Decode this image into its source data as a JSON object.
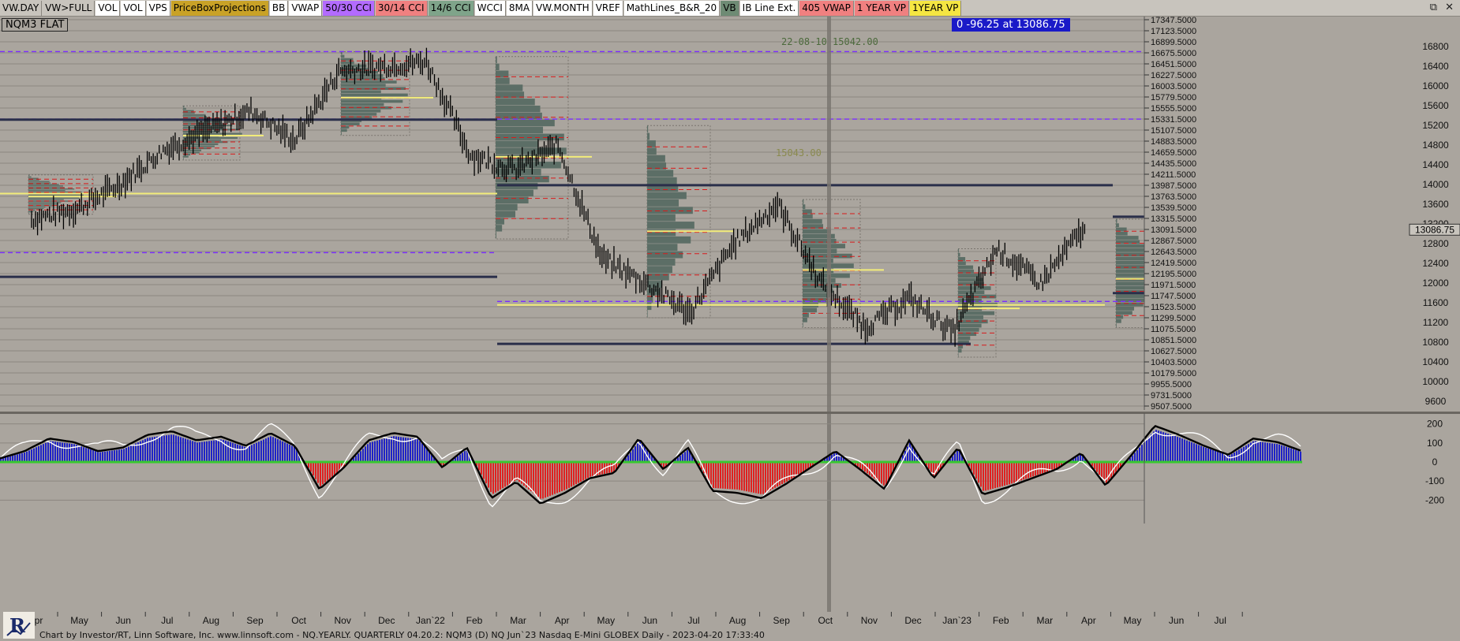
{
  "toolbar": {
    "buttons": [
      {
        "label": "VW.DAY",
        "bg": "#c8c4bd"
      },
      {
        "label": "VW>FULL",
        "bg": "#c8c4bd"
      },
      {
        "label": "VOL",
        "bg": "#ffffff"
      },
      {
        "label": "VOL",
        "bg": "#ffffff"
      },
      {
        "label": "VPS",
        "bg": "#ffffff"
      },
      {
        "label": "PriceBoxProjections",
        "bg": "#c9a227"
      },
      {
        "label": "BB",
        "bg": "#ffffff"
      },
      {
        "label": "VWAP",
        "bg": "#ffffff"
      },
      {
        "label": "50/30 CCI",
        "bg": "#b36bff"
      },
      {
        "label": "30/14 CCI",
        "bg": "#f08080"
      },
      {
        "label": "14/6 CCI",
        "bg": "#7fa48a"
      },
      {
        "label": "WCCI",
        "bg": "#ffffff"
      },
      {
        "label": "8MA",
        "bg": "#ffffff"
      },
      {
        "label": "VW.MONTH",
        "bg": "#ffffff"
      },
      {
        "label": "VREF",
        "bg": "#ffffff"
      },
      {
        "label": "MathLines_B&R_20",
        "bg": "#ffffff"
      },
      {
        "label": "VB",
        "bg": "#6e8b74"
      },
      {
        "label": "IB Line Ext.",
        "bg": "#ffffff"
      },
      {
        "label": "405 VWAP",
        "bg": "#f08080"
      },
      {
        "label": "1 YEAR VP",
        "bg": "#f08080"
      },
      {
        "label": "1YEAR VP",
        "bg": "#f5e642"
      }
    ],
    "window_controls": [
      "⧉",
      "✕"
    ]
  },
  "symbol_label": "NQM3 FLAT",
  "readout": "0  -96.25 at 13086.75",
  "annotations": [
    "22-08-10  15042.00",
    "15043.00"
  ],
  "footer": "Chart by Investor/RT, Linn Software, Inc. www.linnsoft.com - NQ.YEARLY. QUARTERLY    04.20.2: NQM3 (D) NQ Jun`23 Nasdaq E-Mini GLOBEX Daily - 2023-04-20 17:33:40",
  "colors": {
    "background": "#aaa59e",
    "candles": "#000000",
    "profile": "#5c6e66",
    "red_dash": "#d81b1b",
    "purple_dash": "#7b2cff",
    "yellow_line": "#f2ec7a",
    "navy_line": "#2a2f4a",
    "cci_positive": "#1f22c8",
    "cci_negative": "#e02020",
    "cci_zero": "#38c830",
    "cci_fast": "#ffffff",
    "cci_slow": "#000000"
  },
  "chart_data": {
    "type": "line",
    "title": "NQM3 FLAT",
    "price_axis": {
      "labels": [
        "17347.5000",
        "17123.5000",
        "16899.5000",
        "16675.5000",
        "16451.5000",
        "16227.5000",
        "16003.5000",
        "15779.5000",
        "15555.5000",
        "15331.5000",
        "15107.5000",
        "14883.5000",
        "14659.5000",
        "14435.5000",
        "14211.5000",
        "13987.5000",
        "13763.5000",
        "13539.5000",
        "13315.5000",
        "13091.5000",
        "12867.5000",
        "12643.5000",
        "12419.5000",
        "12195.5000",
        "11971.5000",
        "11747.5000",
        "11523.5000",
        "11299.5000",
        "11075.5000",
        "10851.5000",
        "10627.5000",
        "10403.5000",
        "10179.5000",
        "9955.5000",
        "9731.5000",
        "9507.5000"
      ],
      "major_labels": [
        "16800",
        "16400",
        "16000",
        "15600",
        "15200",
        "14800",
        "14400",
        "14000",
        "13600",
        "13200",
        "12800",
        "12400",
        "12000",
        "11600",
        "11200",
        "10800",
        "10400",
        "10000",
        "9600"
      ],
      "ylim": [
        9450,
        17400
      ],
      "last_price_label": "13086.75"
    },
    "x_months": [
      "Apr",
      "May",
      "Jun",
      "Jul",
      "Aug",
      "Sep",
      "Oct",
      "Nov",
      "Dec",
      "Jan`22",
      "Feb",
      "Mar",
      "Apr",
      "May",
      "Jun",
      "Jul",
      "Aug",
      "Sep",
      "Oct",
      "Nov",
      "Dec",
      "Jan`23",
      "Feb",
      "Mar",
      "Apr",
      "May",
      "Jun",
      "Jul"
    ],
    "series": [
      {
        "name": "NQM3",
        "months": [
          "Apr",
          "May",
          "Jun",
          "Jul",
          "Aug",
          "Sep",
          "Oct",
          "Nov",
          "Dec",
          "Jan`22",
          "Feb",
          "Mar",
          "Apr",
          "May",
          "Jun",
          "Jul",
          "Aug",
          "Sep",
          "Oct",
          "Nov",
          "Dec",
          "Jan`23",
          "Feb",
          "Mar",
          "Apr"
        ],
        "values": [
          13300,
          13500,
          14000,
          14700,
          15100,
          15500,
          14900,
          16300,
          16400,
          16500,
          14600,
          14300,
          14800,
          12500,
          12000,
          11400,
          12800,
          13600,
          12000,
          11100,
          11700,
          11000,
          12700,
          12000,
          13150
        ]
      }
    ],
    "cci": {
      "ylim": [
        -260,
        260
      ],
      "levels": [
        "200",
        "100",
        "0",
        "-100",
        "-200"
      ],
      "values": [
        20,
        60,
        130,
        110,
        60,
        80,
        150,
        170,
        120,
        140,
        90,
        160,
        90,
        -150,
        -30,
        120,
        160,
        140,
        -30,
        80,
        -200,
        -110,
        -230,
        -170,
        -90,
        -60,
        130,
        -40,
        80,
        -160,
        -170,
        -200,
        -120,
        -30,
        60,
        -40,
        -150,
        120,
        -90,
        80,
        -180,
        -140,
        -90,
        -40,
        50,
        -130,
        30,
        200,
        150,
        90,
        40,
        130,
        110,
        60
      ]
    }
  }
}
